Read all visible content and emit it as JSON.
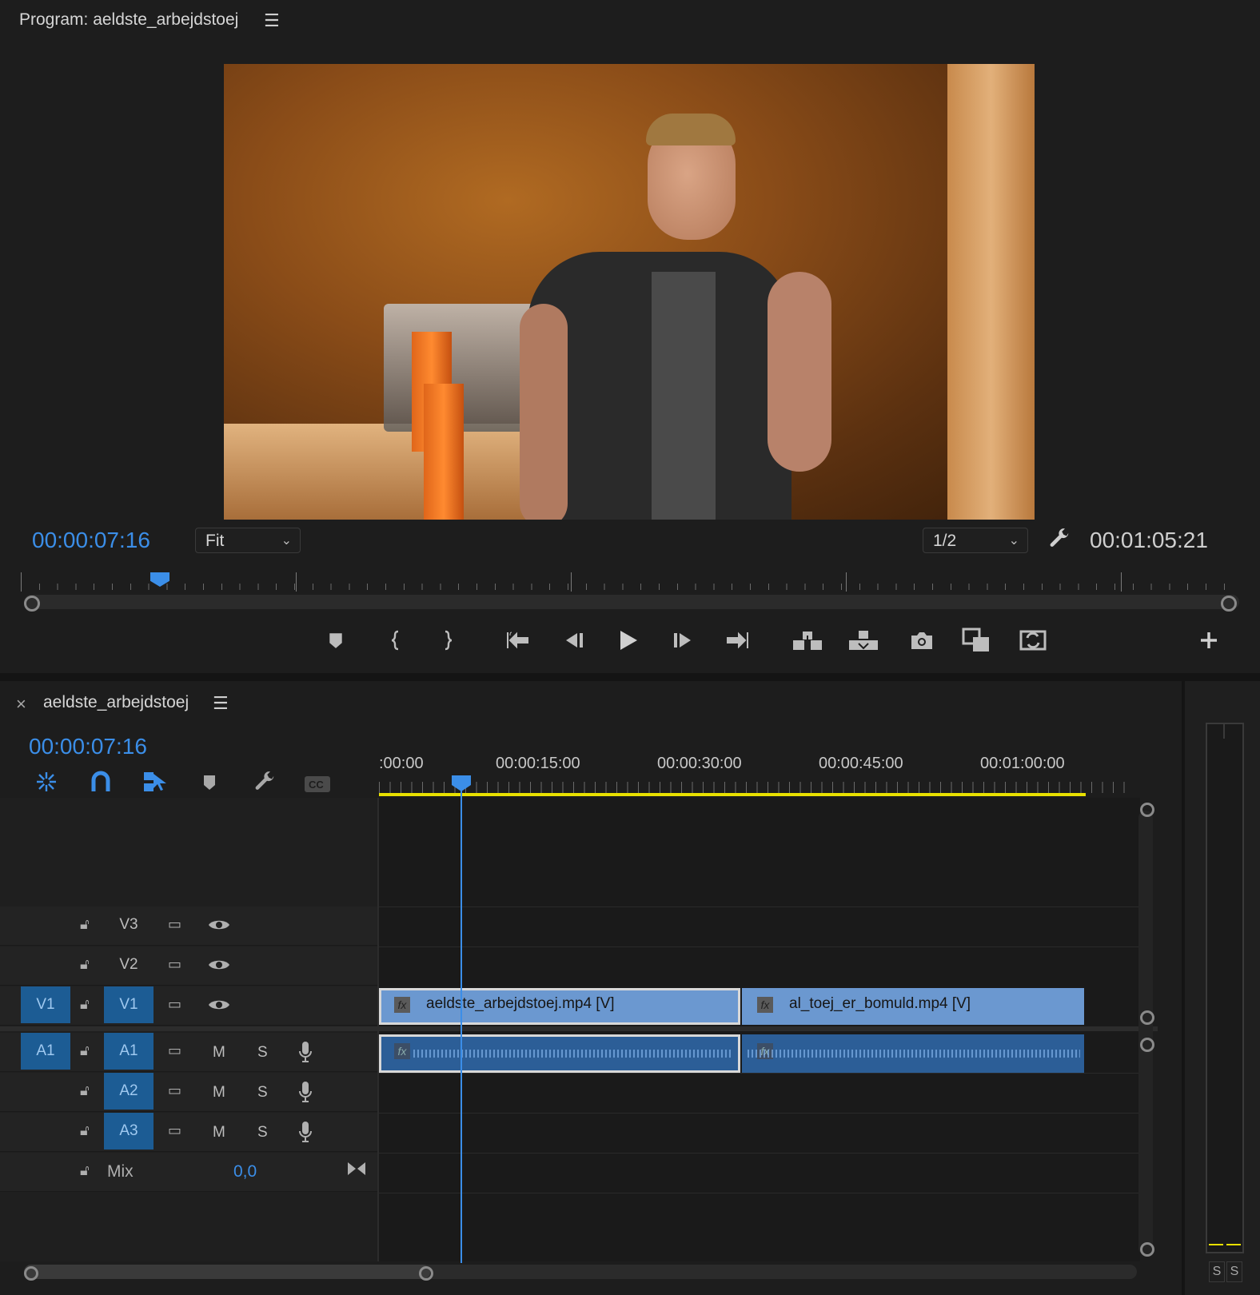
{
  "program_monitor": {
    "title": "Program: aeldste_arbejdstoej",
    "current_timecode": "00:00:07:16",
    "fit_label": "Fit",
    "resolution_label": "1/2",
    "duration_timecode": "00:01:05:21",
    "playhead_fraction": 0.11
  },
  "timeline": {
    "tab_title": "aeldste_arbejdstoej",
    "close_glyph": "×",
    "current_timecode": "00:00:07:16",
    "ruler_labels": [
      ":00:00",
      "00:00:15:00",
      "00:00:30:00",
      "00:00:45:00",
      "00:01:00:00"
    ],
    "video_tracks": [
      {
        "source": "",
        "name": "V3"
      },
      {
        "source": "",
        "name": "V2"
      },
      {
        "source": "V1",
        "name": "V1"
      }
    ],
    "audio_tracks": [
      {
        "source": "A1",
        "name": "A1",
        "m": "M",
        "s": "S"
      },
      {
        "source": "",
        "name": "A2",
        "m": "M",
        "s": "S"
      },
      {
        "source": "",
        "name": "A3",
        "m": "M",
        "s": "S"
      }
    ],
    "mix": {
      "label": "Mix",
      "value": "0,0"
    },
    "clips": {
      "video_1": "aeldste_arbejdstoej.mp4 [V]",
      "video_2": "al_toej_er_bomuld.mp4 [V]",
      "fx": "fx"
    }
  },
  "audio_meter": {
    "solo_labels": [
      "S",
      "S"
    ]
  },
  "colors": {
    "accent_blue": "#3b8ee8",
    "video_clip": "#6b98d0",
    "audio_clip": "#2c5e97",
    "work_area": "#e8e000"
  },
  "icons": [
    "hamburger-menu-icon",
    "wrench-icon",
    "marker-icon",
    "mark-in-icon",
    "mark-out-icon",
    "go-to-in-icon",
    "step-back-icon",
    "play-icon",
    "step-forward-icon",
    "go-to-out-icon",
    "lift-icon",
    "extract-icon",
    "camera-icon",
    "compare-icon",
    "swap-icon",
    "plus-icon",
    "lock-icon",
    "eye-icon",
    "microphone-icon",
    "snap-icon",
    "magnet-icon",
    "linked-selection-icon",
    "captions-icon",
    "bowtie-icon"
  ]
}
